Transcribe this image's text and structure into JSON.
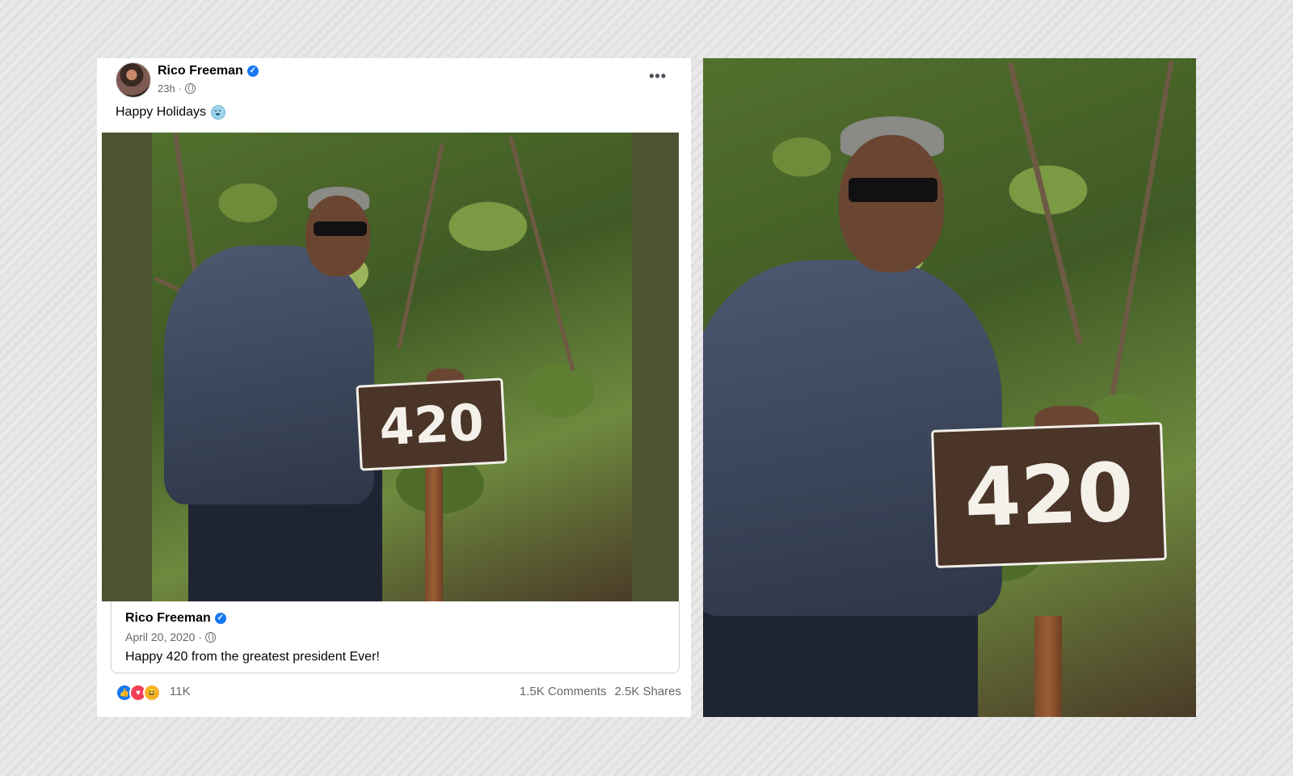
{
  "post": {
    "author": "Rico Freeman",
    "time": "23h",
    "caption": "Happy Holidays",
    "more_label": "•••"
  },
  "photo": {
    "sign_number": "420"
  },
  "shared_post": {
    "author": "Rico Freeman",
    "date": "April 20, 2020",
    "text": "Happy 420 from the greatest president Ever!"
  },
  "footer": {
    "reaction_count": "11K",
    "comments": "1.5K Comments",
    "shares": "2.5K Shares"
  },
  "colors": {
    "verified": "#1877f2",
    "like": "#1877f2",
    "love": "#f33e58",
    "haha": "#f7b125"
  },
  "icons": {
    "verified": "verified-badge-icon",
    "privacy": "globe-icon",
    "caption_emoji": "emoji-icon"
  }
}
